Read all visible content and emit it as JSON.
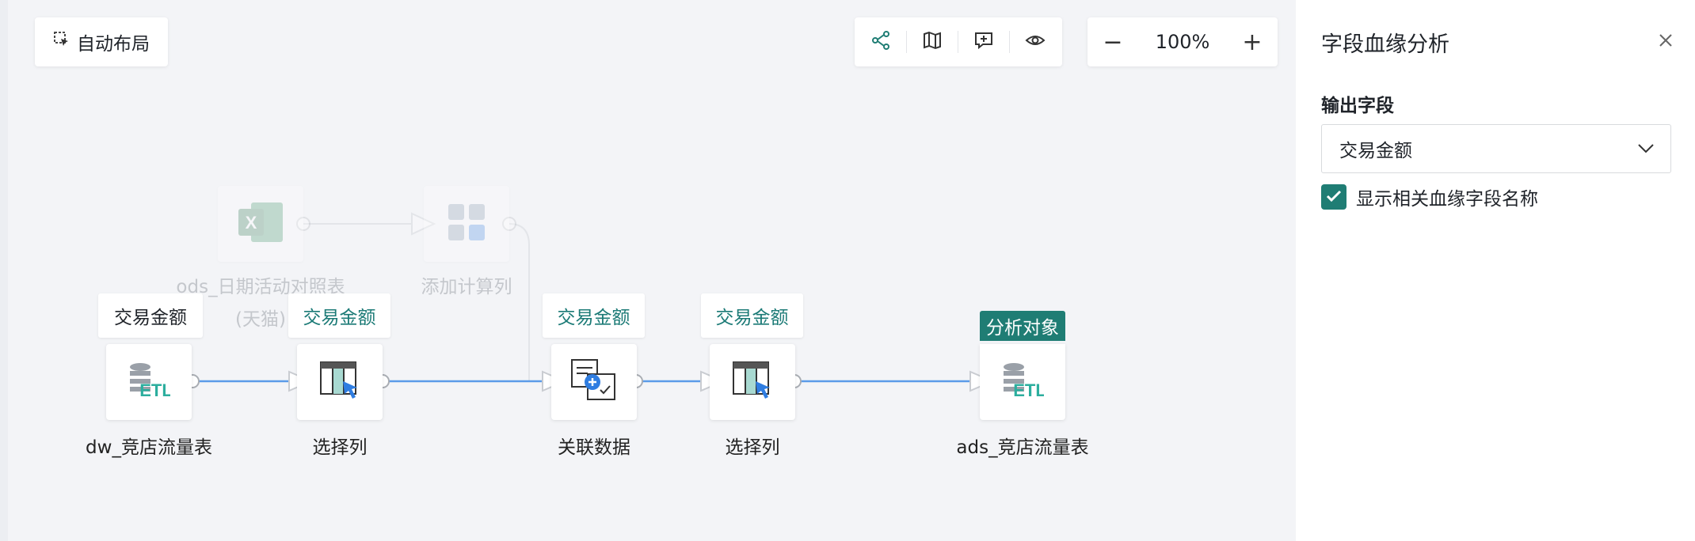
{
  "canvas": {
    "auto_layout_label": "自动布局",
    "zoom": {
      "value": "100%",
      "minus": "−",
      "plus": "+"
    }
  },
  "toolbar": {
    "icons": [
      "lineage-icon",
      "map-icon",
      "comment-icon",
      "eye-icon"
    ]
  },
  "nodes": {
    "excel_source": {
      "label_line1": "ods_日期活动对照表",
      "label_line2": "(天猫)"
    },
    "calc": {
      "label": "添加计算列"
    },
    "dw_table": {
      "label": "dw_竞店流量表",
      "field_tag": "交易金额"
    },
    "select1": {
      "label": "选择列",
      "field_tag": "交易金额"
    },
    "join": {
      "label": "关联数据",
      "field_tag": "交易金额"
    },
    "select2": {
      "label": "选择列",
      "field_tag": "交易金额"
    },
    "ads_table": {
      "label": "ads_竞店流量表",
      "badge": "分析对象"
    }
  },
  "panel": {
    "title": "字段血缘分析",
    "output_field_label": "输出字段",
    "selected_field": "交易金额",
    "show_names_checked": true,
    "show_names_label": "显示相关血缘字段名称"
  },
  "colors": {
    "accent": "#1f7d74",
    "edge": "#5b9be8"
  }
}
